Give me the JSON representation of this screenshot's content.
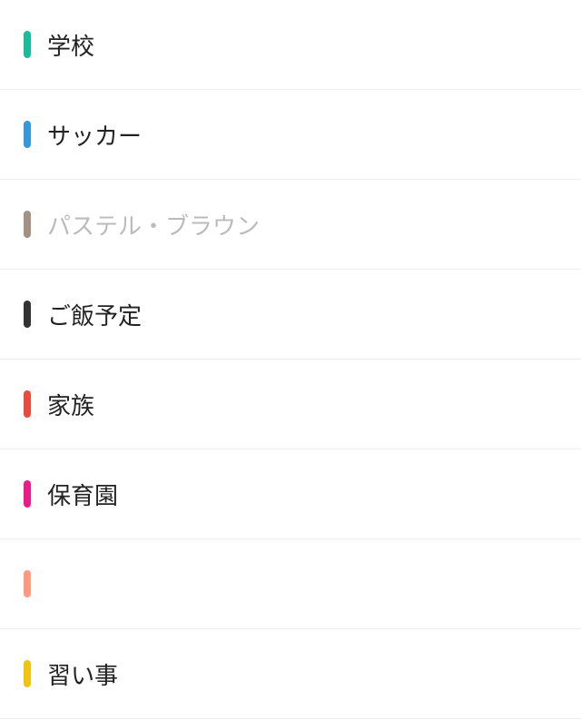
{
  "calendars": [
    {
      "label": "学校",
      "color": "#1abc9c",
      "muted": false
    },
    {
      "label": "サッカー",
      "color": "#3498db",
      "muted": false
    },
    {
      "label": "パステル・ブラウン",
      "color": "#a39184",
      "muted": true
    },
    {
      "label": "ご飯予定",
      "color": "#333333",
      "muted": false
    },
    {
      "label": "家族",
      "color": "#e74c3c",
      "muted": false
    },
    {
      "label": "保育園",
      "color": "#e91e8c",
      "muted": false
    },
    {
      "label": "",
      "color": "#ff9980",
      "muted": false
    },
    {
      "label": "習い事",
      "color": "#f1c40f",
      "muted": false
    }
  ]
}
